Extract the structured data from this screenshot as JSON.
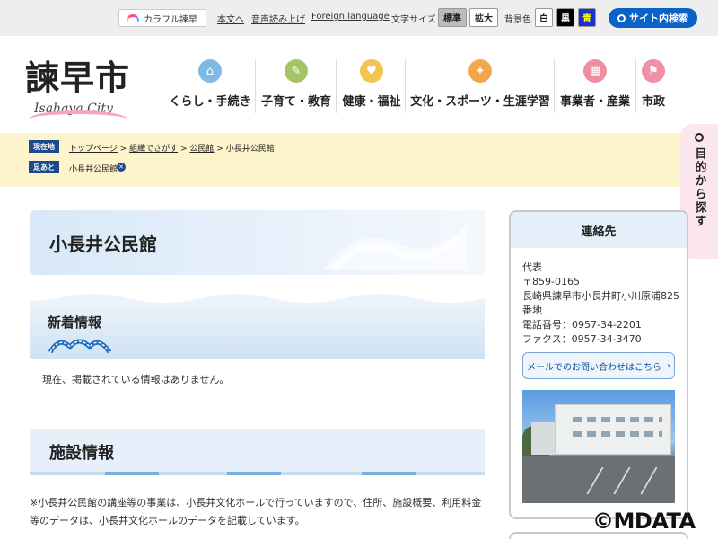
{
  "topbar": {
    "colorful_label": "カラフル諫早",
    "skip_label": "本文へ",
    "read_aloud_label": "音声読み上げ",
    "foreign_label": "Foreign language",
    "text_size_label": "文字サイズ",
    "size_standard": "標準",
    "size_large": "拡大",
    "bg_color_label": "背景色",
    "bg_white": "白",
    "bg_black": "黒",
    "bg_blue": "青",
    "search_label": "サイト内検索"
  },
  "logo": {
    "kanji": "諫早市",
    "sub": "Isahaya City"
  },
  "nav": [
    {
      "label": "くらし・手続き",
      "icon": "house-icon",
      "color": "#7fb9e6"
    },
    {
      "label": "子育て・教育",
      "icon": "rattle-icon",
      "color": "#a7c465"
    },
    {
      "label": "健康・福祉",
      "icon": "heart-icon",
      "color": "#f2c64e"
    },
    {
      "label": "文化・スポーツ・生涯学習",
      "icon": "sports-icon",
      "color": "#f3a74a"
    },
    {
      "label": "事業者・産業",
      "icon": "building-icon",
      "color": "#ee8fa0"
    },
    {
      "label": "市政",
      "icon": "flag-icon",
      "color": "#f08fa6"
    }
  ],
  "breadcrumb": {
    "current_tag": "現在地",
    "items": [
      "トップページ",
      "組織でさがす",
      "公民館",
      "小長井公民館"
    ],
    "trail_tag": "足あと",
    "trail_item": "小長井公民館"
  },
  "sidetab": {
    "label": "目的から探す"
  },
  "page": {
    "title": "小長井公民館",
    "news_heading": "新着情報",
    "news_empty": "現在、掲載されている情報はありません。",
    "facility_heading": "施設情報",
    "facility_note": "※小長井公民館の講座等の事業は、小長井文化ホールで行っていますので、住所、施設概要、利用料金等のデータは、小長井文化ホールのデータを記載しています。"
  },
  "contact": {
    "heading": "連絡先",
    "role": "代表",
    "postal": "〒859-0165",
    "address": "長崎県諫早市小長井町小川原浦825番地",
    "phone": "電話番号：0957-34-2201",
    "fax": "ファクス：0957-34-3470",
    "mail_button": "メールでのお問い合わせはこちら"
  },
  "watermark": "©MDATA",
  "colors": {
    "accent_blue": "#0a62c6",
    "crumb_bg": "#fdf4cc",
    "sidetab_bg": "#fce6ee"
  }
}
